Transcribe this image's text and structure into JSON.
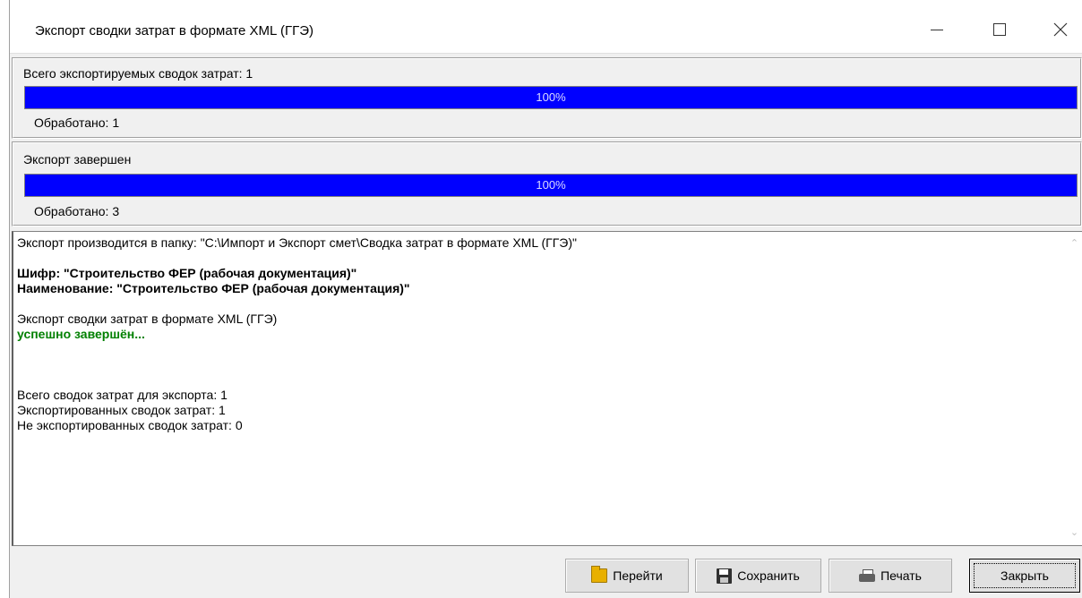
{
  "window": {
    "title": "Экспорт сводки затрат в формате XML (ГГЭ)"
  },
  "panel1": {
    "label": "Всего экспортируемых сводок затрат: 1",
    "progress_percent": 100,
    "progress_text": "100%",
    "processed": "Обработано:  1"
  },
  "panel2": {
    "label": "Экспорт завершен",
    "progress_percent": 100,
    "progress_text": "100%",
    "processed": "Обработано:  3"
  },
  "log": {
    "folder_line": "Экспорт производится в папку: \"C:\\Импорт и Экспорт смет\\Сводка затрат в формате XML (ГГЭ)\"",
    "code_line": "Шифр: \"Строительство ФЕР (рабочая документация)\"",
    "name_line": "Наименование: \"Строительство ФЕР (рабочая документация)\"",
    "export_line": "Экспорт сводки затрат в формате XML (ГГЭ)",
    "success_line": "успешно завершён...",
    "total_line": "Всего сводок затрат для экспорта: 1",
    "exported_line": "Экспортированных сводок затрат: 1",
    "not_exported_line": "Не экспортированных сводок затрат: 0"
  },
  "buttons": {
    "go": "Перейти",
    "save": "Сохранить",
    "print": "Печать",
    "close": "Закрыть"
  },
  "colors": {
    "progress_fill": "#0000ff",
    "success_text": "#008000"
  }
}
